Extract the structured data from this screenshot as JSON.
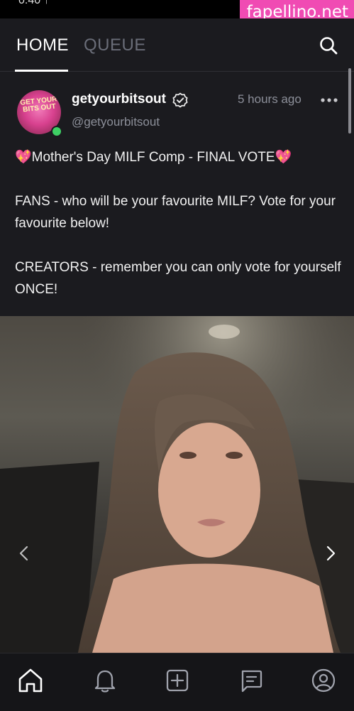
{
  "status_bar": {
    "time": "0:40 ↑"
  },
  "watermark": {
    "text": "fapellino.net"
  },
  "header": {
    "tabs": [
      {
        "label": "HOME",
        "active": true
      },
      {
        "label": "QUEUE",
        "active": false
      }
    ],
    "search_icon": "search-icon"
  },
  "post": {
    "author": {
      "display_name": "getyourbitsout",
      "handle": "@getyourbitsout",
      "avatar_text": "GET YOUR BITS OUT",
      "verified": true,
      "online": true
    },
    "timestamp": "5 hours ago",
    "text": {
      "line1": "💖Mother's Day MILF Comp - FINAL VOTE💖",
      "line2": "FANS - who will be your favourite MILF? Vote for your favourite below!",
      "line3": "CREATORS - remember you can only vote for yourself ONCE!"
    },
    "media": {
      "type": "photo-carousel",
      "prev_icon": "chevron-left-icon",
      "next_icon": "chevron-right-icon"
    }
  },
  "bottom_nav": {
    "items": [
      "home-icon",
      "bell-icon",
      "plus-square-icon",
      "chat-icon",
      "profile-icon"
    ]
  },
  "colors": {
    "background": "#1b1b1f",
    "muted_text": "#8c8f99",
    "online": "#3ecf64",
    "watermark": "#f04bb3"
  }
}
